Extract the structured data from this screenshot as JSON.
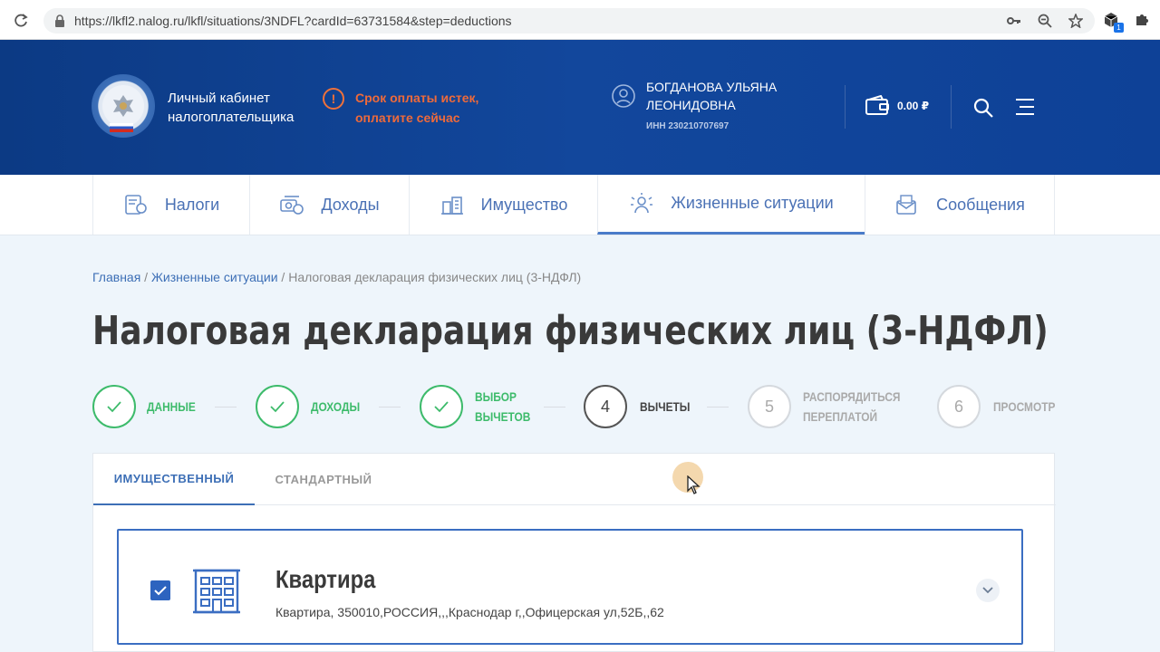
{
  "browser": {
    "url": "https://lkfl2.nalog.ru/lkfl/situations/3NDFL?cardId=63731584&step=deductions",
    "extension_badge": "1"
  },
  "header": {
    "cabinet_title": "Личный кабинет налогоплательщика",
    "warning_text": "Срок оплаты истек, оплатите сейчас",
    "warning_symbol": "!",
    "user_name": "БОГДАНОВА УЛЬЯНА ЛЕОНИДОВНА",
    "user_inn": "ИНН 230210707697",
    "wallet_amount": "0.00 ₽",
    "accent_warning": "#ef6a3a"
  },
  "nav": {
    "items": [
      {
        "label": "Налоги",
        "icon": "taxes-icon"
      },
      {
        "label": "Доходы",
        "icon": "income-icon"
      },
      {
        "label": "Имущество",
        "icon": "property-icon"
      },
      {
        "label": "Жизненные ситуации",
        "icon": "life-situations-icon",
        "active": true
      },
      {
        "label": "Сообщения",
        "icon": "messages-icon"
      }
    ]
  },
  "breadcrumb": {
    "home": "Главная",
    "sep1": " / ",
    "section": "Жизненные ситуации",
    "sep2": " / ",
    "current": "Налоговая декларация физических лиц (3-НДФЛ)"
  },
  "page_title": "Налоговая декларация физических лиц (3-НДФЛ)",
  "steps": [
    {
      "number": "1",
      "label_line1": "ДАННЫЕ",
      "label_line2": "",
      "state": "done"
    },
    {
      "number": "2",
      "label_line1": "ДОХОДЫ",
      "label_line2": "",
      "state": "done"
    },
    {
      "number": "3",
      "label_line1": "ВЫБОР",
      "label_line2": "ВЫЧЕТОВ",
      "state": "done"
    },
    {
      "number": "4",
      "label_line1": "ВЫЧЕТЫ",
      "label_line2": "",
      "state": "current"
    },
    {
      "number": "5",
      "label_line1": "РАСПОРЯДИТЬСЯ",
      "label_line2": "ПЕРЕПЛАТОЙ",
      "state": "future"
    },
    {
      "number": "6",
      "label_line1": "ПРОСМОТР",
      "label_line2": "",
      "state": "future"
    }
  ],
  "tabs": [
    {
      "label": "ИМУЩЕСТВЕННЫЙ",
      "active": true
    },
    {
      "label": "СТАНДАРТНЫЙ",
      "active": false
    }
  ],
  "property": {
    "title": "Квартира",
    "address": "Квартира, 350010,РОССИЯ,,,Краснодар г,,Офицерская ул,52Б,,62",
    "checked": true
  }
}
